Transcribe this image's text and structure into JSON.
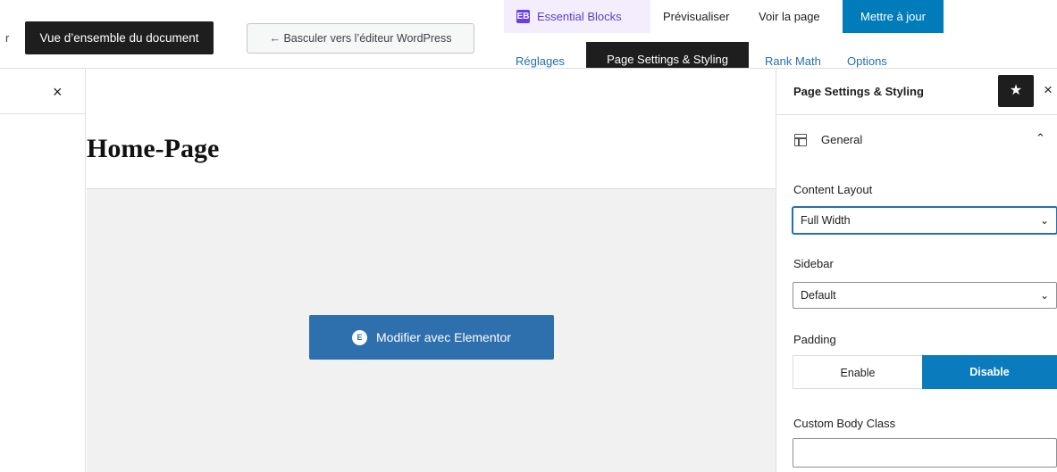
{
  "toolbar": {
    "cut_letter": "r",
    "tooltip": "Vue d’ensemble du document",
    "switch_editor": "← Basculer vers l’éditeur WordPress",
    "essential_blocks": "Essential Blocks",
    "essential_blocks_logo": "EB",
    "preview": "Prévisualiser",
    "view_page": "Voir la page",
    "update": "Mettre à jour"
  },
  "sub_tabs": {
    "settings": "Réglages",
    "page_settings": "Page Settings & Styling",
    "rank_math": "Rank Math",
    "options": "Options"
  },
  "left_panel": {
    "close_icon": "×"
  },
  "editor": {
    "title": "Home-Page",
    "elementor_button": "Modifier avec Elementor",
    "elementor_icon": "E"
  },
  "sidebar": {
    "title": "Page Settings & Styling",
    "star_icon": "★",
    "close_icon": "×",
    "section": {
      "label": "General",
      "chevron": "⌃"
    },
    "content_layout": {
      "label": "Content Layout",
      "value": "Full Width"
    },
    "sidebar_field": {
      "label": "Sidebar",
      "value": "Default"
    },
    "padding": {
      "label": "Padding",
      "enable": "Enable",
      "disable": "Disable",
      "selected": "Disable"
    },
    "custom_body_class": {
      "label": "Custom Body Class",
      "value": ""
    },
    "select_chevron": "⌄"
  },
  "colors": {
    "primary": "#007cba",
    "essential_blocks_bg": "#f3edfd",
    "essential_blocks_text": "#5b3fd6",
    "elementor_button": "#2e6fad",
    "dark": "#1e1e1e"
  }
}
